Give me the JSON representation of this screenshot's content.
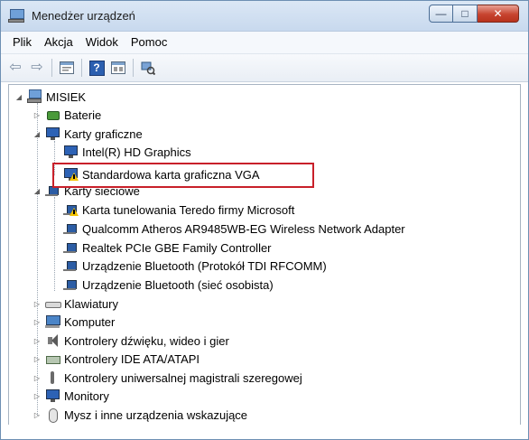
{
  "window": {
    "title": "Menedżer urządzeń",
    "controls": {
      "minimize": "—",
      "maximize": "□",
      "close": "✕"
    }
  },
  "menu": [
    "Plik",
    "Akcja",
    "Widok",
    "Pomoc"
  ],
  "toolbar": {
    "icons": [
      "back-arrow-icon",
      "forward-arrow-icon",
      "properties-icon",
      "help-icon",
      "view-icon",
      "scan-hardware-icon"
    ],
    "help_glyph": "?"
  },
  "tree": {
    "root": "MISIEK",
    "items": [
      {
        "label": "Baterie",
        "level": 1,
        "expander": "▷",
        "icon": "battery-icon"
      },
      {
        "label": "Karty graficzne",
        "level": 1,
        "expander": "◢",
        "icon": "display-adapter-icon"
      },
      {
        "label": "Intel(R) HD Graphics",
        "level": 2,
        "icon": "display-adapter-icon"
      },
      {
        "label": "Standardowa karta graficzna VGA",
        "level": 2,
        "icon": "display-adapter-warning-icon",
        "warning": true,
        "highlighted": true
      },
      {
        "label": "Karty sieciowe",
        "level": 1,
        "expander": "◢",
        "icon": "network-adapter-icon"
      },
      {
        "label": "Karta tunelowania Teredo firmy Microsoft",
        "level": 2,
        "icon": "network-adapter-icon",
        "warning": true
      },
      {
        "label": "Qualcomm Atheros AR9485WB-EG Wireless Network Adapter",
        "level": 2,
        "icon": "network-adapter-icon"
      },
      {
        "label": "Realtek PCIe GBE Family Controller",
        "level": 2,
        "icon": "network-adapter-icon"
      },
      {
        "label": "Urządzenie Bluetooth (Protokół TDI RFCOMM)",
        "level": 2,
        "icon": "network-adapter-icon"
      },
      {
        "label": "Urządzenie Bluetooth (sieć osobista)",
        "level": 2,
        "icon": "network-adapter-icon"
      },
      {
        "label": "Klawiatury",
        "level": 1,
        "expander": "▷",
        "icon": "keyboard-icon"
      },
      {
        "label": "Komputer",
        "level": 1,
        "expander": "▷",
        "icon": "computer-icon"
      },
      {
        "label": "Kontrolery dźwięku, wideo i gier",
        "level": 1,
        "expander": "▷",
        "icon": "sound-icon"
      },
      {
        "label": "Kontrolery IDE ATA/ATAPI",
        "level": 1,
        "expander": "▷",
        "icon": "ide-controller-icon"
      },
      {
        "label": "Kontrolery uniwersalnej magistrali szeregowej",
        "level": 1,
        "expander": "▷",
        "icon": "usb-icon"
      },
      {
        "label": "Monitory",
        "level": 1,
        "expander": "▷",
        "icon": "monitor-icon"
      },
      {
        "label": "Mysz i inne urządzenia wskazujące",
        "level": 1,
        "expander": "▷",
        "icon": "mouse-icon"
      }
    ]
  },
  "colors": {
    "highlight_border": "#c8202a",
    "warning": "#f2c200"
  }
}
